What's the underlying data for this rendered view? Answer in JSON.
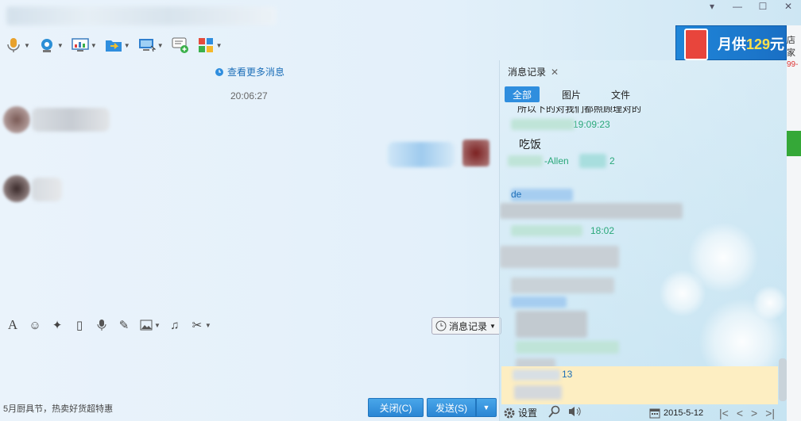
{
  "window": {
    "controls": [
      "▾",
      "—",
      "☐",
      "✕"
    ]
  },
  "toolbar": {
    "icons": [
      "microphone-icon",
      "camera-icon",
      "screen-share-icon",
      "file-transfer-icon",
      "remote-desktop-icon",
      "new-chat-icon",
      "apps-icon"
    ]
  },
  "ad": {
    "prefix": "月供",
    "amount": "129",
    "suffix": "元"
  },
  "right_edge": {
    "text1": "店家",
    "text2": "99-"
  },
  "chat": {
    "more_messages": "查看更多消息",
    "timestamp": "20:06:27"
  },
  "input_toolbar": {
    "history_button": "消息记录"
  },
  "footer": {
    "promo": "5月厨具节，热卖好货超特惠",
    "close_button": "关闭(C)",
    "send_button": "发送(S)"
  },
  "history_panel": {
    "tab_title": "消息记录",
    "filters": [
      "全部",
      "图片",
      "文件"
    ],
    "active_filter": "全部",
    "lines": [
      {
        "text": "所以下的对我们都照顾理对的",
        "color": "#222"
      },
      {
        "text": "19:09:23",
        "color": "#2aa87a"
      },
      {
        "text": "吃饭",
        "color": "#222"
      },
      {
        "text": "-Allen",
        "color": "#2aa87a"
      },
      {
        "text": "2",
        "color": "#2aa87a"
      },
      {
        "text": "de",
        "color": "#1d6fb8"
      },
      {
        "text": "18:02",
        "color": "#2aa87a"
      },
      {
        "text": "13",
        "color": "#1d6fb8"
      }
    ],
    "settings_label": "设置",
    "date": "2015-5-12",
    "nav": [
      "|<",
      "<",
      ">",
      ">|"
    ]
  }
}
